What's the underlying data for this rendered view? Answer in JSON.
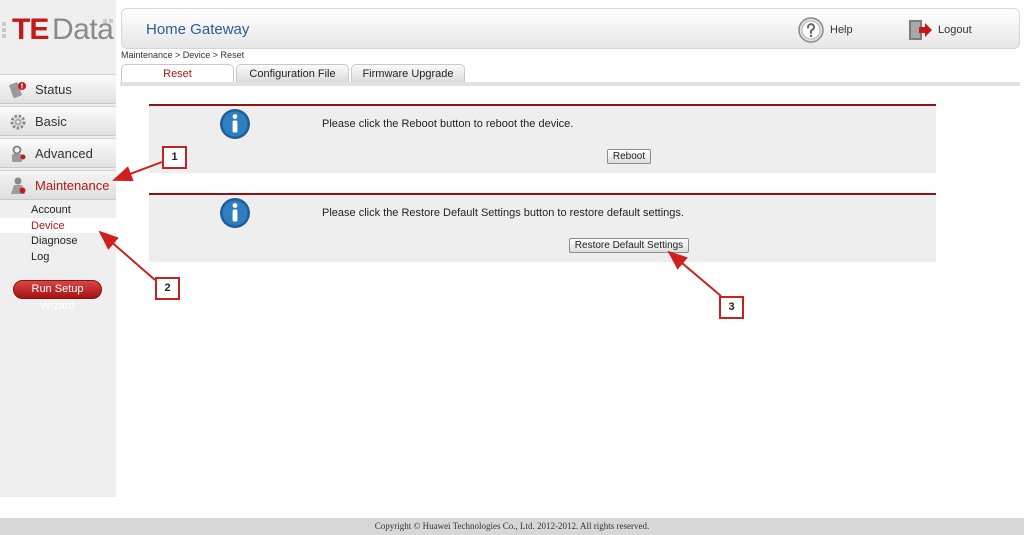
{
  "brand": {
    "logo_primary": "TE",
    "logo_secondary": "Data",
    "accent_color": "#b01b1b"
  },
  "header": {
    "title": "Home Gateway",
    "help_label": "Help",
    "logout_label": "Logout"
  },
  "breadcrumb": "Maintenance > Device > Reset",
  "sidebar": {
    "items": [
      {
        "label": "Status",
        "icon": "status-icon"
      },
      {
        "label": "Basic",
        "icon": "gear-icon"
      },
      {
        "label": "Advanced",
        "icon": "advanced-icon"
      },
      {
        "label": "Maintenance",
        "icon": "maintenance-icon",
        "active": true
      }
    ],
    "subitems": [
      {
        "label": "Account"
      },
      {
        "label": "Device",
        "active": true
      },
      {
        "label": "Diagnose"
      },
      {
        "label": "Log"
      }
    ],
    "wizard_label": "Run Setup Wizard"
  },
  "tabs": [
    {
      "label": "Reset",
      "active": true
    },
    {
      "label": "Configuration File"
    },
    {
      "label": "Firmware Upgrade"
    }
  ],
  "panels": [
    {
      "text": "Please click the Reboot button to reboot the device.",
      "button": "Reboot"
    },
    {
      "text": "Please click the Restore Default Settings button to restore default settings.",
      "button": "Restore Default Settings"
    }
  ],
  "annotations": [
    "1",
    "2",
    "3"
  ],
  "footer": "Copyright © Huawei Technologies Co., Ltd. 2012-2012. All rights reserved."
}
